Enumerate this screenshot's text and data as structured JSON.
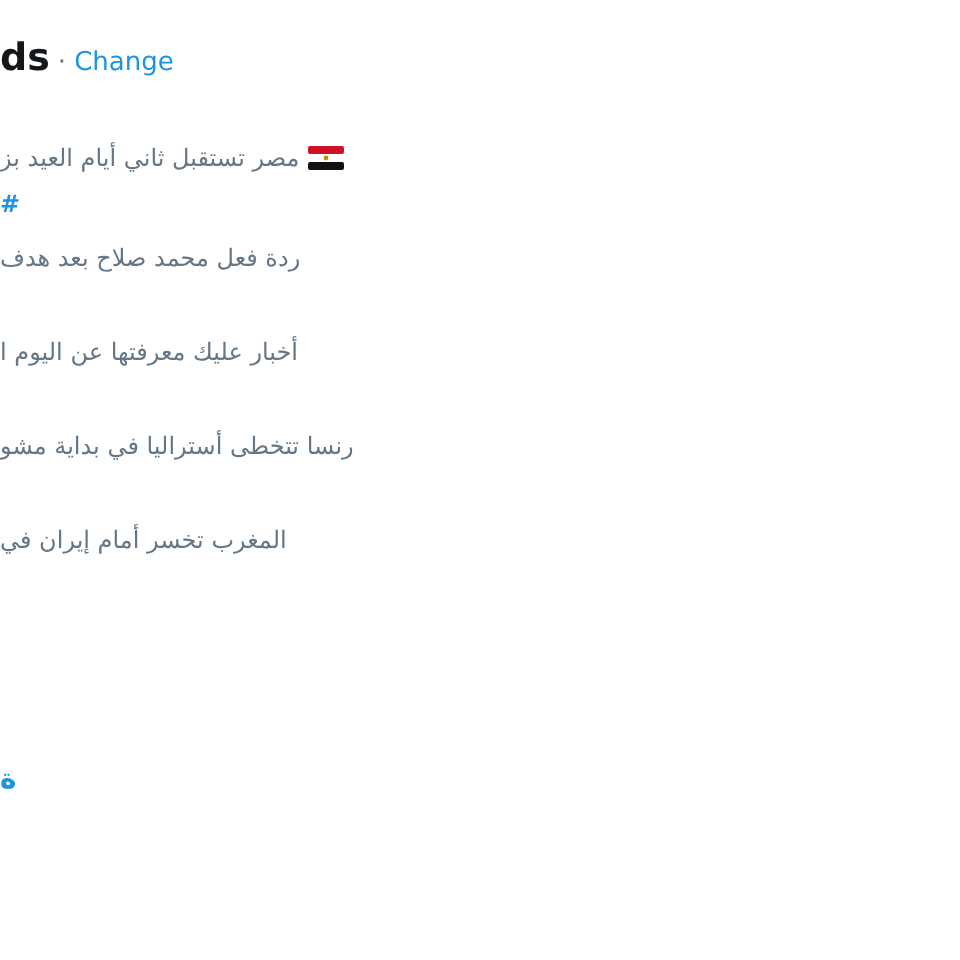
{
  "header": {
    "title": "ds",
    "separator": "·",
    "link": "Change"
  },
  "trends": [
    {
      "kind": "text",
      "text": "مصر تستقبل ثاني أيام العيد بز",
      "flag": true
    },
    {
      "kind": "hashtag",
      "text": "#"
    },
    {
      "kind": "text",
      "text": "ردة فعل محمد صلاح بعد هدف",
      "flag": false
    },
    {
      "kind": "text",
      "text": "أخبار عليك معرفتها عن اليوم ا",
      "flag": false
    },
    {
      "kind": "text",
      "text": "رنسا تتخطى أستراليا في بداية مشو",
      "flag": false
    },
    {
      "kind": "text",
      "text": "المغرب تخسر أمام إيران في",
      "flag": false
    }
  ],
  "footer_link": "ة"
}
